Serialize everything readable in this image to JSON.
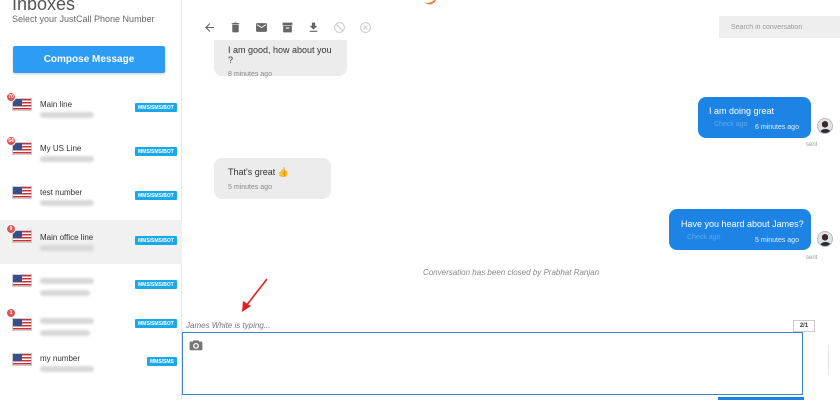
{
  "sidebar": {
    "title": "Inboxes",
    "subtitle": "Select your JustCall Phone Number",
    "compose_label": "Compose Message",
    "lines": [
      {
        "name": "Main line",
        "badge": "70",
        "tag": "MMS/SMS/BOT",
        "active": false
      },
      {
        "name": "My US Line",
        "badge": "54",
        "tag": "MMS/SMS/BOT",
        "active": false
      },
      {
        "name": "test number",
        "badge": "",
        "tag": "MMS/SMS/BOT",
        "active": false
      },
      {
        "name": "Main office line",
        "badge": "9",
        "tag": "MMS/SMS/BOT",
        "active": true
      },
      {
        "name": "",
        "badge": "",
        "tag": "MMS/SMS/BOT",
        "active": false
      },
      {
        "name": "",
        "badge": "1",
        "tag": "MMS/SMS/BOT",
        "active": false
      },
      {
        "name": "my number",
        "badge": "",
        "tag": "MMS/SMS",
        "active": false
      }
    ]
  },
  "toolbar": {
    "icons": [
      "back-arrow-icon",
      "trash-icon",
      "envelope-icon",
      "archive-icon",
      "download-icon",
      "block-icon",
      "close-circle-icon"
    ],
    "search_placeholder": "Search in conversation"
  },
  "messages": {
    "m1": {
      "text": "I am good, how about you ?",
      "time": "8 minutes ago"
    },
    "m2": {
      "text": "I am doing great",
      "time": "6 minutes ago",
      "status": "sent"
    },
    "m3": {
      "text": "That's great 👍",
      "time": "5 minutes ago"
    },
    "m4": {
      "text": "Have you heard about James?",
      "time": "5 minutes ago",
      "status": "sent"
    }
  },
  "closed_note": "Conversation has been closed by Prabhat Ranjan",
  "typing_indicator": "James White is typing...",
  "counter": "2/1",
  "colors": {
    "accent": "#1d84e5",
    "compose": "#2d9cf5",
    "tag": "#1aa9e8",
    "badge": "#e05252",
    "arrow": "#e02020"
  }
}
